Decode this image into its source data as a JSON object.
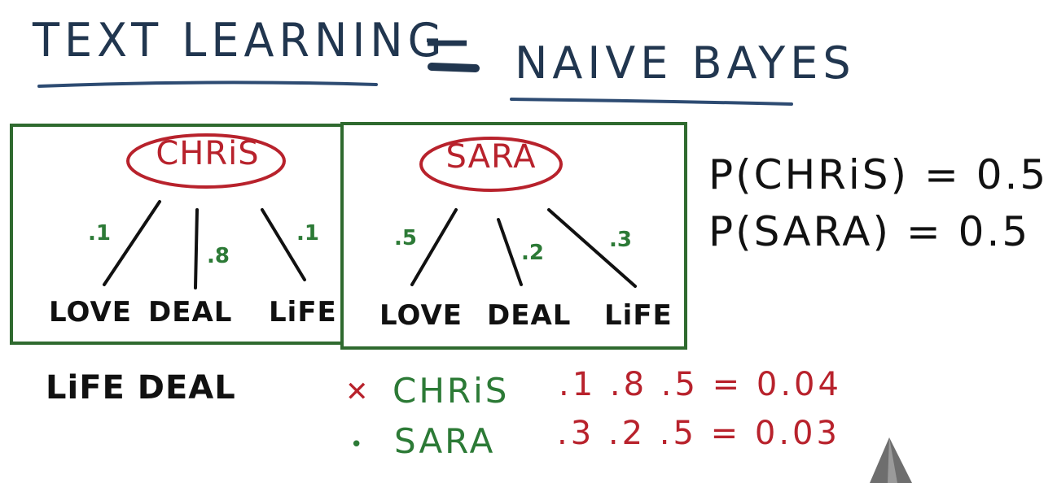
{
  "title": {
    "left": "TEXT LEARNING",
    "dash": "—",
    "right": "NAIVE BAYES"
  },
  "colors": {
    "title": "#21364f",
    "box_border": "#2f6a2f",
    "name_red": "#b8222c",
    "prob_green": "#2c7a36",
    "ink": "#111111"
  },
  "chris_box": {
    "name": "CHRiS",
    "words": [
      "LOVE",
      "DEAL",
      "LiFE"
    ],
    "probs": [
      ".1",
      ".8",
      ".1"
    ]
  },
  "sara_box": {
    "name": "SARA",
    "words": [
      "LOVE",
      "DEAL",
      "LiFE"
    ],
    "probs": [
      ".5",
      ".2",
      ".3"
    ]
  },
  "priors": {
    "chris": "P(CHRiS) = 0.5",
    "sara": "P(SARA) = 0.5"
  },
  "query": {
    "text": "LiFE DEAL"
  },
  "results": [
    {
      "mark": "✕",
      "name": "CHRiS",
      "calc": ".1  .8  .5  =  0.04"
    },
    {
      "mark": "•",
      "name": "SARA",
      "calc": ".3  .2  .5  =  0.03"
    }
  ]
}
